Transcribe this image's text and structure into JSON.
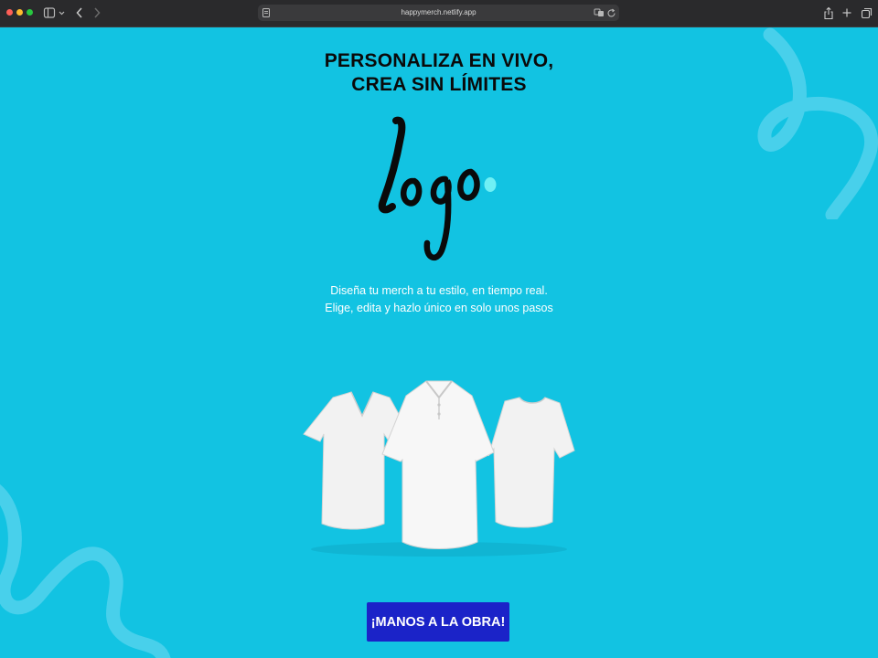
{
  "browser": {
    "url": "happymerch.netlify.app",
    "icons": {
      "sidebar": "sidebar-icon",
      "back": "back-chevron-icon",
      "forward": "forward-chevron-icon",
      "reader": "reader-icon",
      "translate": "translate-icon",
      "reload": "reload-icon",
      "share": "share-icon",
      "new_tab": "new-tab-icon",
      "tabs": "tab-overview-icon"
    }
  },
  "hero": {
    "title_line1": "PERSONALIZA EN VIVO,",
    "title_line2": "CREA SIN LÍMITES",
    "logo_text": "Logo",
    "tagline_line1": "Diseña tu merch a tu estilo, en tiempo real.",
    "tagline_line2": "Elige, edita y hazlo único en solo unos pasos",
    "products_image": "three white t-shirts",
    "cta_label": "¡MANOS A LA OBRA!"
  },
  "colors": {
    "background": "#12c3e2",
    "cta": "#1b23c8",
    "accent_dot": "#6ff0f5",
    "title": "#0a0a0a"
  }
}
